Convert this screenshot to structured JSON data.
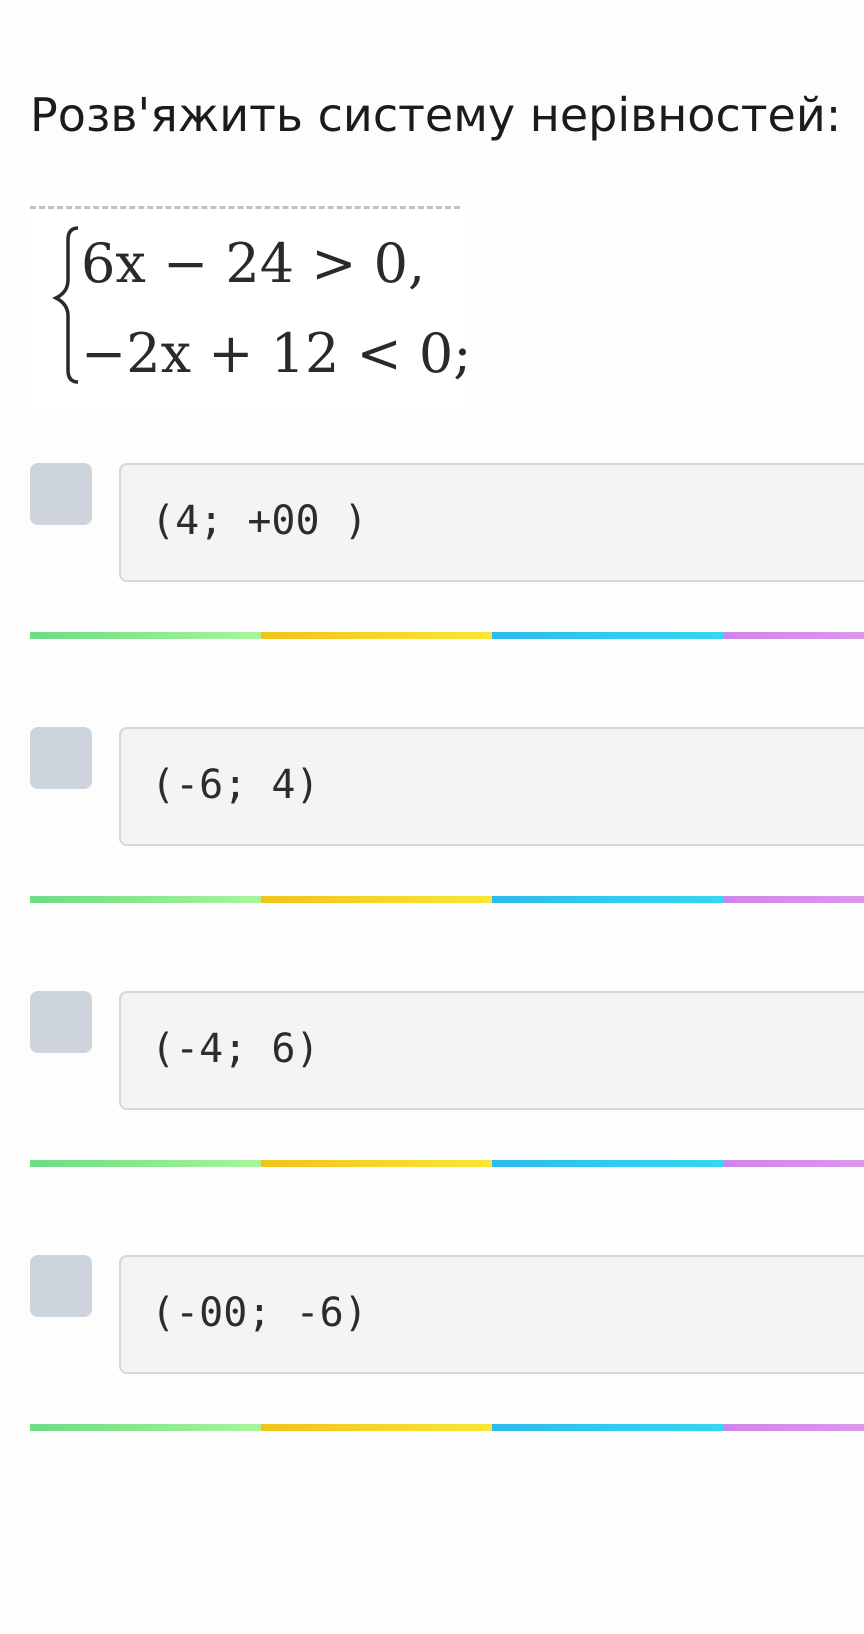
{
  "question": {
    "title": "Розв'яжить систему нерівностей:"
  },
  "system": {
    "line1": "6x − 24 > 0,",
    "line2": "−2x + 12 < 0;"
  },
  "options": [
    {
      "label": "(4; +00 )",
      "checked": false
    },
    {
      "label": "(-6; 4)",
      "checked": false
    },
    {
      "label": "(-4; 6)",
      "checked": false
    },
    {
      "label": "(-00; -6)",
      "checked": false
    }
  ],
  "colors": {
    "checkbox": "#cdd4dc",
    "answer_background": "#f4f4f4",
    "divider_green": "#6cdc84",
    "divider_yellow": "#f2c21e",
    "divider_blue": "#2bbcec",
    "divider_purple": "#cf86ea"
  }
}
